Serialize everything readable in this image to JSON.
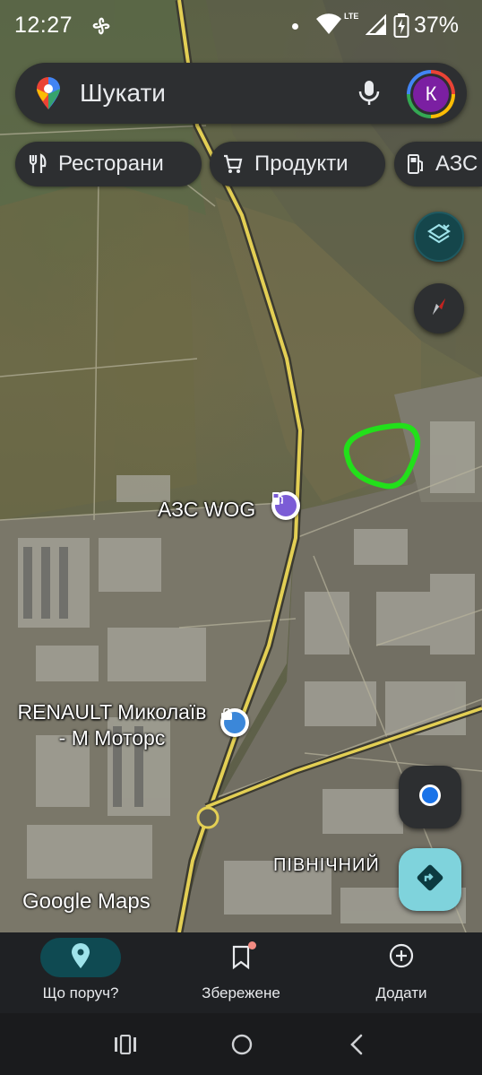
{
  "status_bar": {
    "time": "12:27",
    "network": "LTE",
    "battery_percent": "37%"
  },
  "search": {
    "placeholder": "Шукати",
    "avatar_letter": "К"
  },
  "chips": [
    {
      "label": "Ресторани",
      "icon": "fork-knife-icon"
    },
    {
      "label": "Продукти",
      "icon": "cart-icon"
    },
    {
      "label": "АЗС",
      "icon": "gas-station-icon"
    }
  ],
  "map": {
    "poi": [
      {
        "name": "АЗС WOG",
        "icon": "gas-station-icon",
        "color": "#7b5cd6"
      },
      {
        "name_line1": "RENAULT Миколаїв",
        "name_line2": "- М Моторс",
        "icon": "shopping-bag-icon",
        "color": "#3b87d9"
      }
    ],
    "district_label": "ПІВНІЧНИЙ",
    "attribution": "Google Maps",
    "annotation_color": "#22e01a"
  },
  "bottom_nav": {
    "items": [
      {
        "label": "Що поруч?",
        "icon": "location-pin-icon",
        "active": true
      },
      {
        "label": "Збережене",
        "icon": "bookmark-icon",
        "active": false,
        "badge": true
      },
      {
        "label": "Додати",
        "icon": "add-circle-icon",
        "active": false
      }
    ]
  },
  "colors": {
    "accent": "#7fd3dc",
    "surface": "#2d2f31",
    "nav_active": "#0f4a52"
  }
}
